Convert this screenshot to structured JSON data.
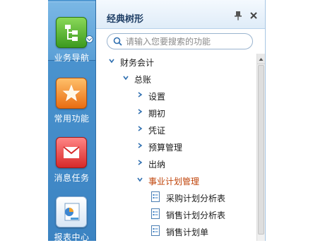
{
  "rail": {
    "items": [
      {
        "label": "业务导航",
        "icon": "business-nav-icon",
        "active": true
      },
      {
        "label": "常用功能",
        "icon": "star-icon",
        "active": false
      },
      {
        "label": "消息任务",
        "icon": "envelope-icon",
        "active": false
      },
      {
        "label": "报表中心",
        "icon": "report-icon",
        "active": false
      }
    ]
  },
  "panel": {
    "title": "经典树形",
    "search_placeholder": "请输入您要搜索的功能"
  },
  "tree": {
    "finance": "财务会计",
    "ledger": "总账",
    "settings": "设置",
    "opening": "期初",
    "voucher": "凭证",
    "budget": "预算管理",
    "cashier": "出纳",
    "business_plan": "事业计划管理",
    "purchase_analysis": "采购计划分析表",
    "sales_analysis": "销售计划分析表",
    "sales_plan": "销售计划单"
  },
  "colors": {
    "rail_bg": "#3b83c2",
    "highlight_text": "#c0440a",
    "title_text": "#1f3f66"
  }
}
